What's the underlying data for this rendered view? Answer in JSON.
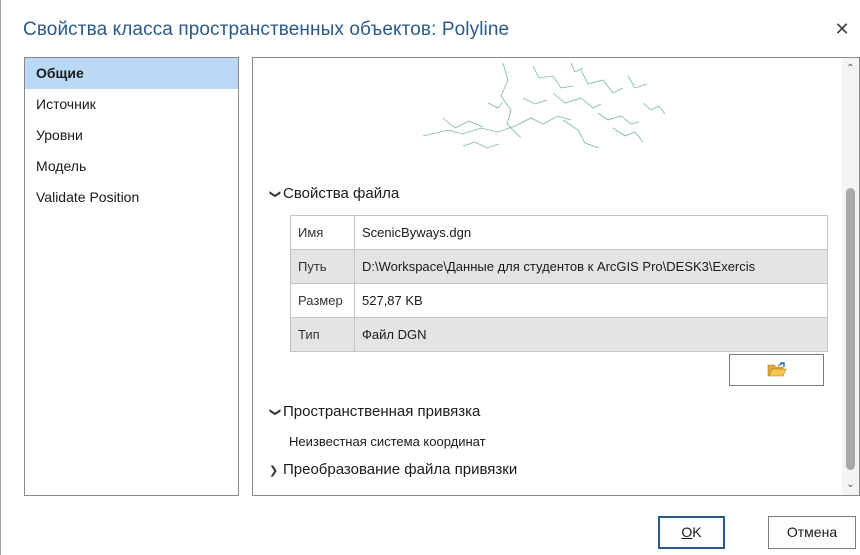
{
  "window": {
    "title": "Свойства класса пространственных объектов: Polyline",
    "close_glyph": "✕"
  },
  "sidebar": {
    "items": [
      {
        "label": "Общие",
        "selected": true
      },
      {
        "label": "Источник",
        "selected": false
      },
      {
        "label": "Уровни",
        "selected": false
      },
      {
        "label": "Модель",
        "selected": false
      },
      {
        "label": "Validate Position",
        "selected": false
      }
    ]
  },
  "file_properties": {
    "header": "Свойства файла",
    "rows": [
      {
        "key": "Имя",
        "value": "ScenicByways.dgn"
      },
      {
        "key": "Путь",
        "value": "D:\\Workspace\\Данные для студентов к ArcGIS Pro\\DESK3\\Exercis"
      },
      {
        "key": "Размер",
        "value": "527,87 KB"
      },
      {
        "key": "Тип",
        "value": "Файл DGN"
      }
    ],
    "browse_icon": "folder-open-icon"
  },
  "spatial_reference": {
    "header": "Пространственная привязка",
    "value": "Неизвестная система координат"
  },
  "transform": {
    "header": "Преобразование файла привязки"
  },
  "buttons": {
    "ok_label": "OK",
    "ok_mnemonic": "O",
    "ok_rest": "K",
    "cancel_label": "Отмена"
  },
  "colors": {
    "title": "#2b5a88",
    "selection": "#b9d9f5",
    "ok_border": "#2b5a88",
    "preview_lines": "#4a9e8a"
  }
}
